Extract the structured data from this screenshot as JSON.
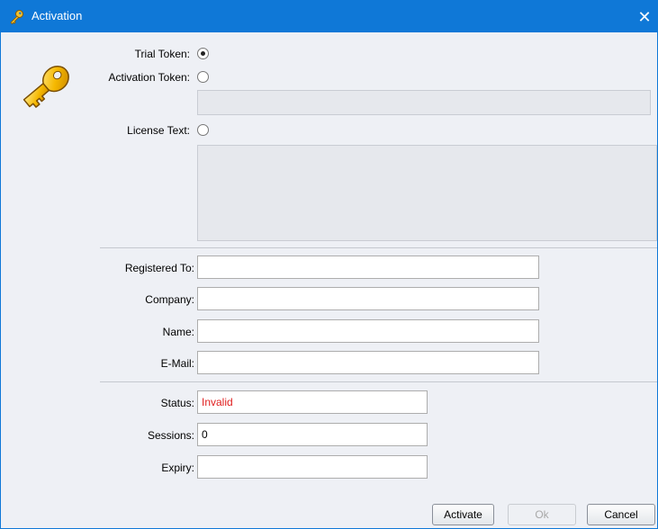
{
  "window": {
    "title": "Activation",
    "close_glyph": "✕"
  },
  "form": {
    "trial_token_label": "Trial Token:",
    "activation_token_label": "Activation Token:",
    "license_text_label": "License Text:",
    "registered_to_label": "Registered To:",
    "company_label": "Company:",
    "name_label": "Name:",
    "email_label": "E-Mail:",
    "status_label": "Status:",
    "sessions_label": "Sessions:",
    "expiry_label": "Expiry:",
    "selected_option": "trial_token",
    "status_value": "Invalid",
    "sessions_value": "0",
    "registered_to_value": "",
    "company_value": "",
    "name_value": "",
    "email_value": "",
    "expiry_value": ""
  },
  "buttons": {
    "activate": "Activate",
    "ok": "Ok",
    "cancel": "Cancel"
  },
  "colors": {
    "titlebar": "#0f78d7",
    "status_invalid": "#e02020"
  },
  "icons": {
    "title": "key-icon",
    "main": "key-icon"
  }
}
